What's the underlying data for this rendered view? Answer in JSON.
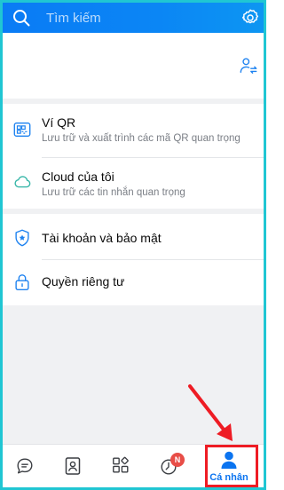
{
  "header": {
    "search_placeholder": "Tìm kiếm"
  },
  "sections": {
    "qr": {
      "title": "Ví QR",
      "subtitle": "Lưu trữ và xuất trình các mã QR quan trọng"
    },
    "cloud": {
      "title": "Cloud của tôi",
      "subtitle": "Lưu trữ các tin nhắn quan trọng"
    },
    "security": {
      "title": "Tài khoản và bảo mật"
    },
    "privacy": {
      "title": "Quyền riêng tư"
    }
  },
  "bottom_nav": {
    "items": [
      {
        "icon": "chat-icon"
      },
      {
        "icon": "contacts-icon"
      },
      {
        "icon": "discover-icon"
      },
      {
        "icon": "timeline-icon",
        "badge": "N"
      },
      {
        "icon": "profile-icon",
        "label": "Cá nhân"
      }
    ]
  },
  "colors": {
    "header_blue": "#0a7bf5",
    "accent_blue": "#0b74f0",
    "highlight_red": "#ee1c24",
    "frame_cyan": "#20c6d3"
  }
}
